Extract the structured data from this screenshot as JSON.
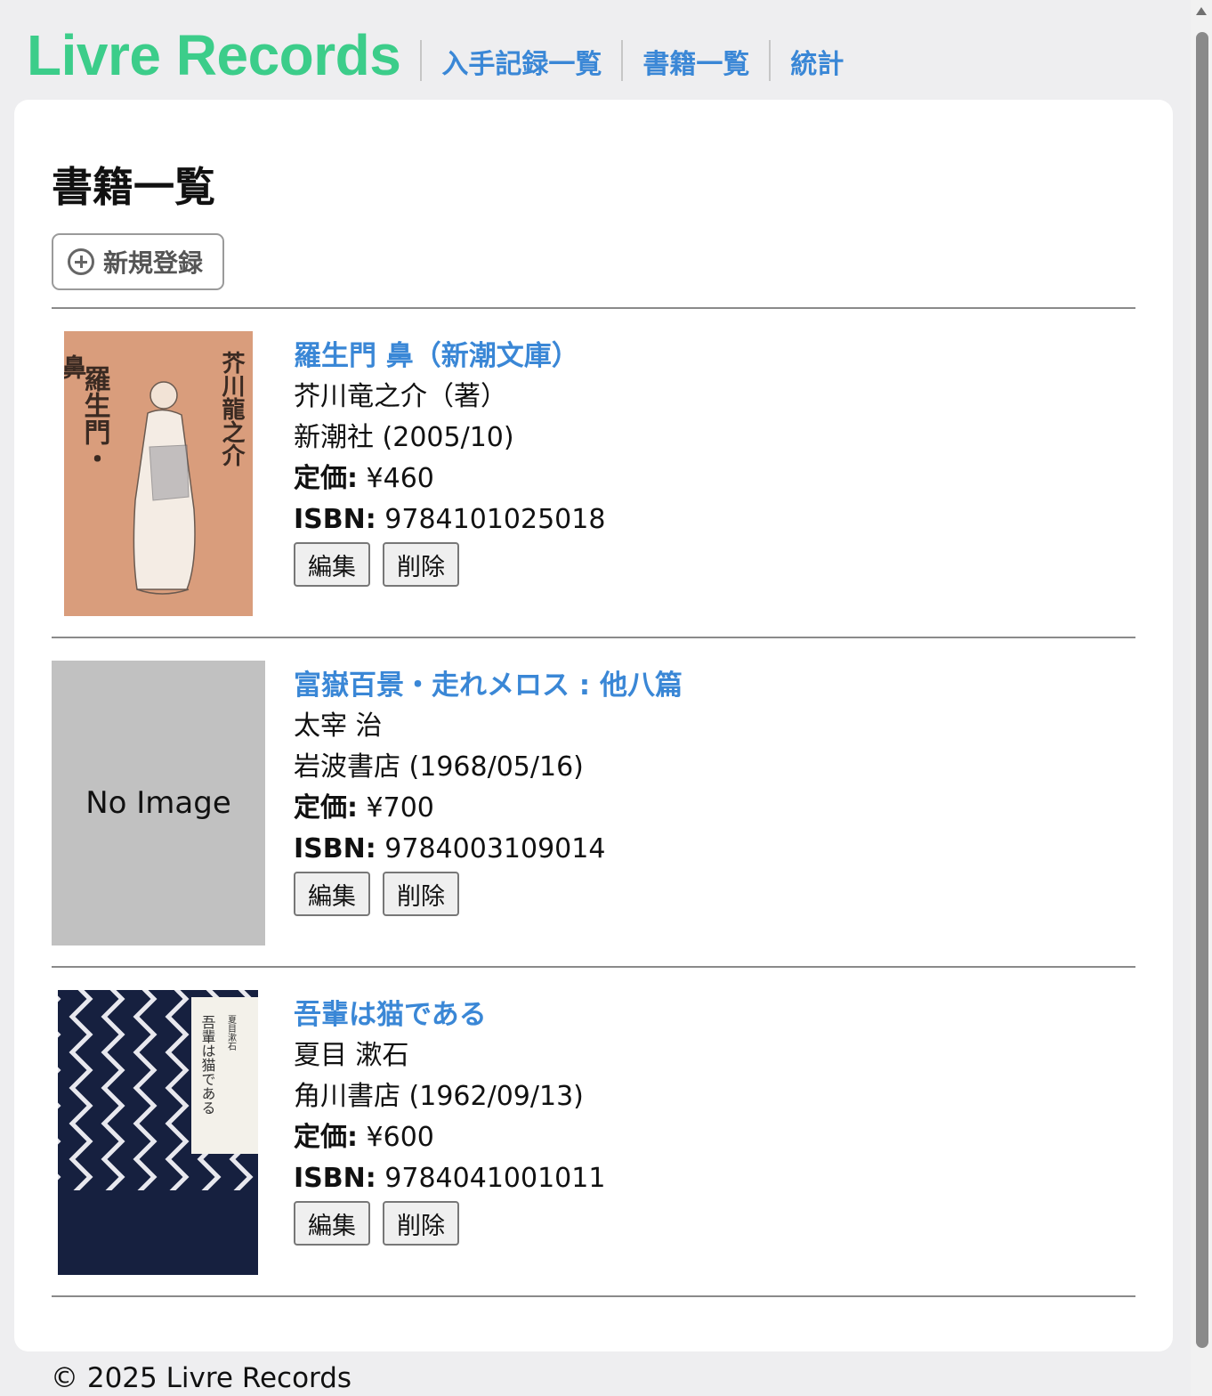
{
  "app": {
    "logo": "Livre Records",
    "nav": [
      "入手記録一覧",
      "書籍一覧",
      "統計"
    ]
  },
  "page": {
    "title": "書籍一覧",
    "new_button_label": "新規登録"
  },
  "labels": {
    "price": "定価:",
    "isbn": "ISBN:",
    "edit": "編集",
    "delete": "削除",
    "no_image": "No Image"
  },
  "books": [
    {
      "title": "羅生門 鼻（新潮文庫）",
      "author": "芥川竜之介（著）",
      "publisher": "新潮社 (2005/10)",
      "price": "¥460",
      "isbn": "9784101025018",
      "cover_text": [
        "羅生門・",
        "鼻",
        "芥川龍之介"
      ]
    },
    {
      "title": "富嶽百景・走れメロス : 他八篇",
      "author": "太宰 治",
      "publisher": "岩波書店 (1968/05/16)",
      "price": "¥700",
      "isbn": "9784003109014"
    },
    {
      "title": "吾輩は猫である",
      "author": "夏目 漱石",
      "publisher": "角川書店 (1962/09/13)",
      "price": "¥600",
      "isbn": "9784041001011",
      "cover_text": [
        "吾輩は猫である",
        "夏目漱石"
      ]
    }
  ],
  "footer": "© 2025 Livre Records"
}
